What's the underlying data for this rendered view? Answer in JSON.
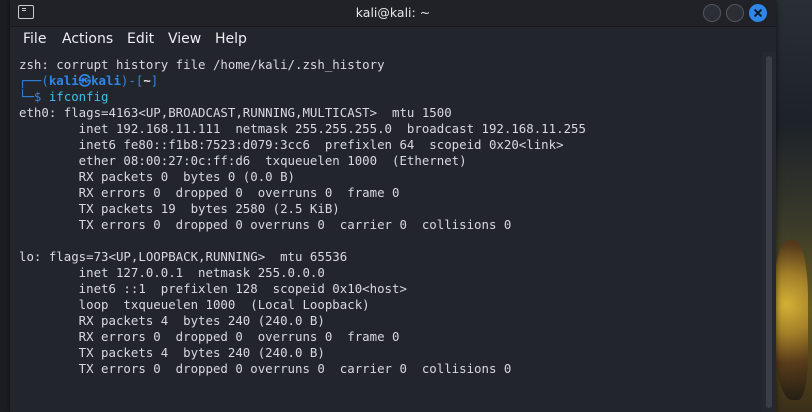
{
  "window": {
    "title": "kali@kali: ~"
  },
  "menu": {
    "items": [
      "File",
      "Actions",
      "Edit",
      "View",
      "Help"
    ]
  },
  "terminal": {
    "warning": "zsh: corrupt history file /home/kali/.zsh_history",
    "prompt": {
      "line1_prefix": "┌──(",
      "user": "kali㉿kali",
      "line1_mid": ")-[",
      "path": "~",
      "line1_suffix": "]",
      "line2_prefix": "└─$ ",
      "command": "ifconfig"
    },
    "output": [
      "eth0: flags=4163<UP,BROADCAST,RUNNING,MULTICAST>  mtu 1500",
      "        inet 192.168.11.111  netmask 255.255.255.0  broadcast 192.168.11.255",
      "        inet6 fe80::f1b8:7523:d079:3cc6  prefixlen 64  scopeid 0x20<link>",
      "        ether 08:00:27:0c:ff:d6  txqueuelen 1000  (Ethernet)",
      "        RX packets 0  bytes 0 (0.0 B)",
      "        RX errors 0  dropped 0  overruns 0  frame 0",
      "        TX packets 19  bytes 2580 (2.5 KiB)",
      "        TX errors 0  dropped 0 overruns 0  carrier 0  collisions 0",
      "",
      "lo: flags=73<UP,LOOPBACK,RUNNING>  mtu 65536",
      "        inet 127.0.0.1  netmask 255.0.0.0",
      "        inet6 ::1  prefixlen 128  scopeid 0x10<host>",
      "        loop  txqueuelen 1000  (Local Loopback)",
      "        RX packets 4  bytes 240 (240.0 B)",
      "        RX errors 0  dropped 0  overruns 0  frame 0",
      "        TX packets 4  bytes 240 (240.0 B)",
      "        TX errors 0  dropped 0 overruns 0  carrier 0  collisions 0"
    ]
  },
  "colors": {
    "prompt_accent": "#2f86e6",
    "command": "#3fc0e6",
    "close_button": "#2f86e6"
  },
  "icons": {
    "app": "terminal-icon",
    "minimize": "minimize-icon",
    "maximize": "maximize-icon",
    "close": "close-icon"
  }
}
